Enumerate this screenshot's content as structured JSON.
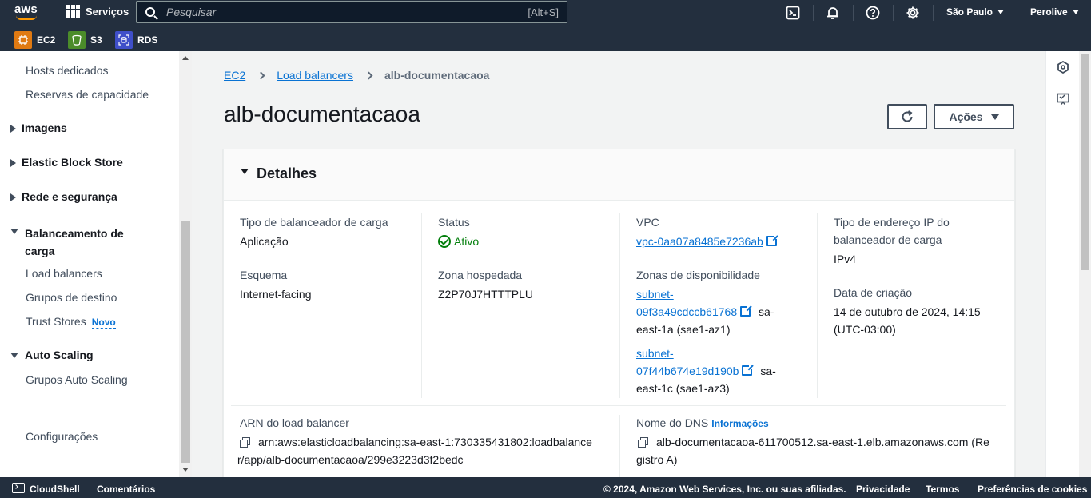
{
  "topnav": {
    "logo": "aws",
    "services_label": "Serviços",
    "search_placeholder": "Pesquisar",
    "search_shortcut": "[Alt+S]",
    "region": "São Paulo",
    "account": "Perolive",
    "icons": [
      "cloudshell-icon",
      "bell-icon",
      "help-icon",
      "gear-icon"
    ]
  },
  "favorites": [
    {
      "label": "EC2",
      "color": "#e07a12"
    },
    {
      "label": "S3",
      "color": "#4b8c2a"
    },
    {
      "label": "RDS",
      "color": "#3f4fc9"
    }
  ],
  "sidebar": {
    "hosts": "Hosts dedicados",
    "reservas": "Reservas de capacidade",
    "imagens": "Imagens",
    "ebs": "Elastic Block Store",
    "rede": "Rede e segurança",
    "balanceamento_1": "Balanceamento de",
    "balanceamento_2": "carga",
    "load_balancers": "Load balancers",
    "grupos_destino": "Grupos de destino",
    "trust_stores": "Trust Stores",
    "novo": "Novo",
    "auto_scaling": "Auto Scaling",
    "grupos_auto_scaling": "Grupos Auto Scaling",
    "configuracoes": "Configurações"
  },
  "breadcrumb": {
    "ec2": "EC2",
    "load_balancers": "Load balancers",
    "current": "alb-documentacaoa"
  },
  "page": {
    "title": "alb-documentacaoa",
    "actions_label": "Ações"
  },
  "details": {
    "title": "Detalhes",
    "tipo_label": "Tipo de balanceador de carga",
    "tipo_value": "Aplicação",
    "esquema_label": "Esquema",
    "esquema_value": "Internet-facing",
    "status_label": "Status",
    "status_value": "Ativo",
    "zona_label": "Zona hospedada",
    "zona_value": "Z2P70J7HTTTPLU",
    "vpc_label": "VPC",
    "vpc_value": "vpc-0aa07a8485e7236ab",
    "zonas_label": "Zonas de disponibilidade",
    "subnet1_a": "subnet-",
    "subnet1_b": "09f3a49cdccb61768",
    "subnet1_az_a": "sa-",
    "subnet1_az_b": "east-1a (sae1-az1)",
    "subnet2_a": "subnet-",
    "subnet2_b": "07f44b674e19d190b",
    "subnet2_az_a": "sa-",
    "subnet2_az_b": "east-1c (sae1-az3)",
    "ip_label_1": "Tipo de endereço IP do",
    "ip_label_2": "balanceador de carga",
    "ip_value": "IPv4",
    "data_label": "Data de criação",
    "data_value_1": "14 de outubro de 2024, 14:15",
    "data_value_2": "(UTC-03:00)",
    "arn_label": "ARN do load balancer",
    "arn_value_1": "arn:aws:elasticloadbalancing:sa-east-1:730335431802:loadbalance",
    "arn_value_2": "r/app/alb-documentacaoa/299e3223d3f2bedc",
    "dns_label": "Nome do DNS",
    "dns_info": "Informações",
    "dns_value_1": "alb-documentacaoa-611700512.sa-east-1.elb.amazonaws.com (Re",
    "dns_value_2": "gistro A)"
  },
  "footer": {
    "cloudshell": "CloudShell",
    "comentarios": "Comentários",
    "copyright": "© 2024, Amazon Web Services, Inc. ou suas afiliadas.",
    "privacidade": "Privacidade",
    "termos": "Termos",
    "cookies": "Preferências de cookies"
  }
}
